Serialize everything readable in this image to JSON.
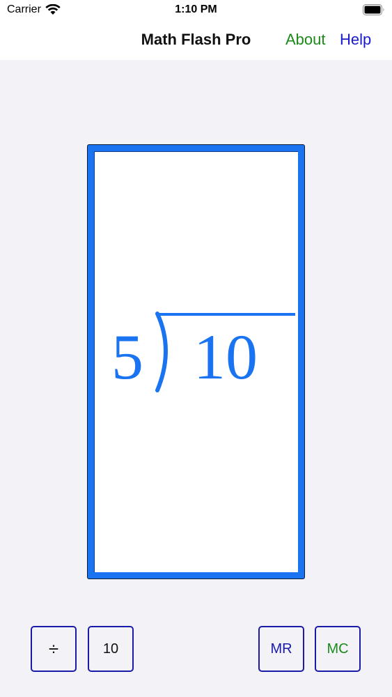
{
  "status_bar": {
    "carrier": "Carrier",
    "time": "1:10 PM"
  },
  "nav": {
    "title": "Math Flash Pro",
    "about_label": "About",
    "help_label": "Help"
  },
  "problem": {
    "divisor": "5",
    "dividend": "10",
    "operation": "division"
  },
  "buttons": {
    "operation_label": "÷",
    "range_label": "10",
    "mr_label": "MR",
    "mc_label": "MC"
  },
  "colors": {
    "card_border": "#1a73f0",
    "about": "#1a8a1a",
    "help": "#1a1acc",
    "button_border": "#1a1aa8"
  }
}
